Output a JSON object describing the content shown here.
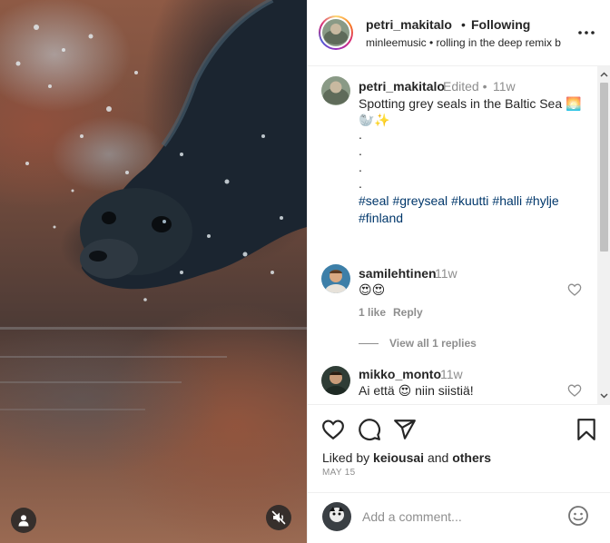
{
  "header": {
    "username": "petri_makitalo",
    "separator": "•",
    "follow_label": "Following",
    "audio_text": "minleemusic • rolling in the deep remix b"
  },
  "caption": {
    "username": "petri_makitalo",
    "edited": "Edited •",
    "time": "11w",
    "text": "Spotting grey seals in the Baltic Sea 🌅 🦭✨",
    "dots": [
      ".",
      ".",
      ".",
      "."
    ],
    "hashtags": [
      "#seal",
      "#greyseal",
      "#kuutti",
      "#halli",
      "#hylje",
      "#finland"
    ]
  },
  "comments": [
    {
      "username": "samilehtinen",
      "time": "11w",
      "text": "😍😍",
      "likes_label": "1 like",
      "reply_label": "Reply",
      "view_replies": "View all 1 replies"
    },
    {
      "username": "mikko_monto",
      "time": "11w",
      "text": "Ai että 😍 niin siistiä!"
    }
  ],
  "footer": {
    "liked_prefix": "Liked by",
    "liked_user": "keiousai",
    "liked_and": "and",
    "liked_others": "others",
    "date": "MAY 15",
    "comment_placeholder": "Add a comment..."
  },
  "icons": {
    "more": "more-horizontal-icon",
    "like": "heart-icon",
    "comment": "comment-icon",
    "share": "paper-plane-icon",
    "save": "bookmark-icon",
    "emoji": "emoji-icon",
    "tags": "user-tag-icon",
    "mute": "speaker-muted-icon"
  }
}
